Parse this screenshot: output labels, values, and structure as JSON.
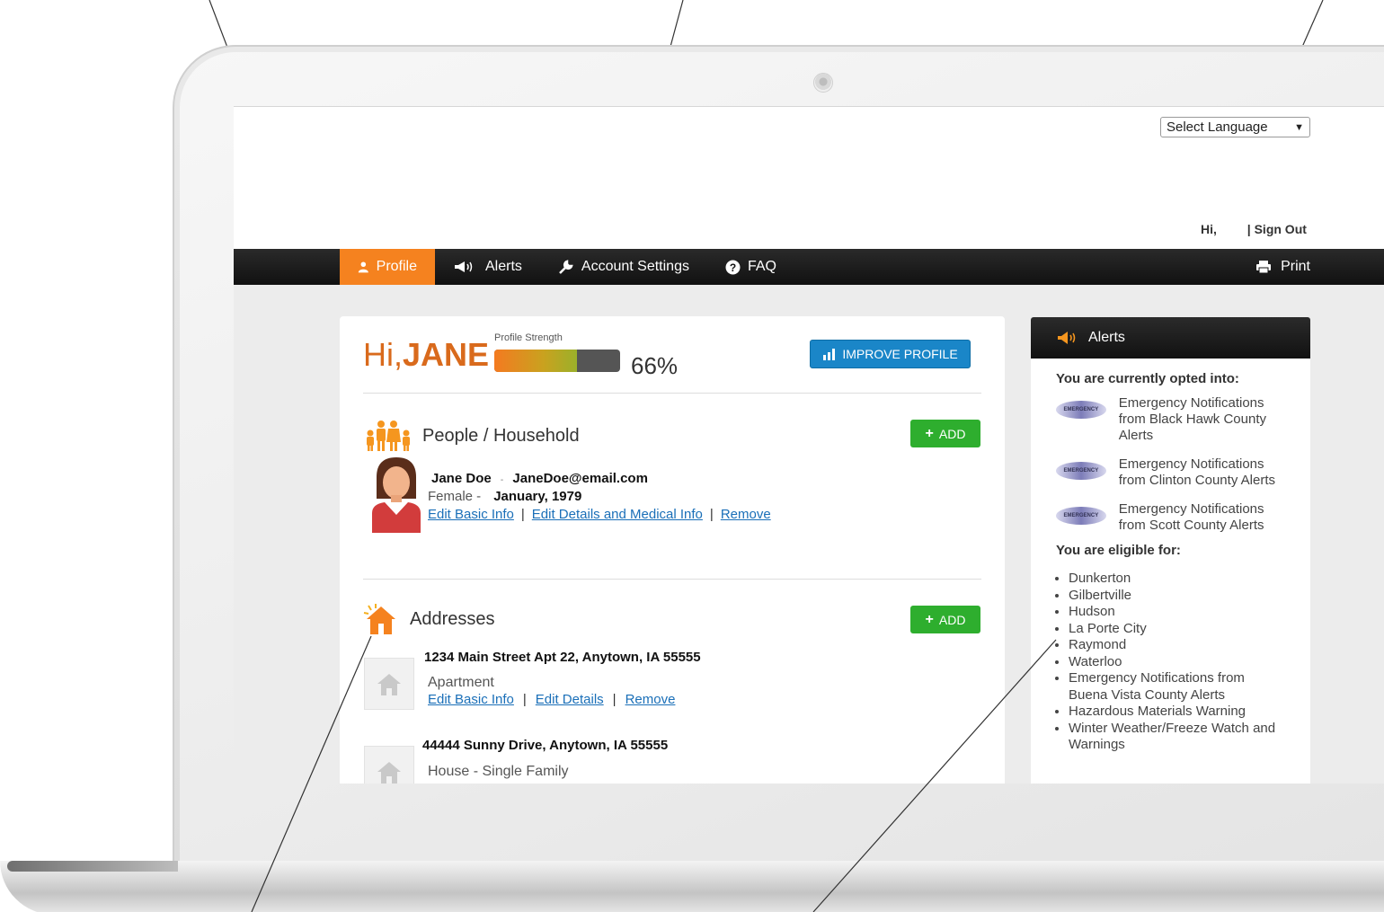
{
  "header": {
    "language_select": "Select Language",
    "greeting": "Hi,",
    "sign_out": "| Sign Out"
  },
  "nav": {
    "items": [
      {
        "label": "Profile",
        "icon": "person-icon",
        "active": true
      },
      {
        "label": "Alerts",
        "icon": "megaphone-icon",
        "active": false
      },
      {
        "label": "Account Settings",
        "icon": "wrench-icon",
        "active": false
      },
      {
        "label": "FAQ",
        "icon": "question-icon",
        "active": false
      }
    ],
    "print": "Print"
  },
  "profile": {
    "hi": "Hi,",
    "name": "JANE",
    "strength_label": "Profile Strength",
    "strength_pct": "66%",
    "strength_value": 0.66,
    "improve_button": "IMPROVE PROFILE"
  },
  "people": {
    "title": "People / Household",
    "add_label": "ADD",
    "person": {
      "name": "Jane Doe",
      "separator": "-",
      "email": "JaneDoe@email.com",
      "gender": "Female -",
      "birth": "January, 1979",
      "links": [
        "Edit Basic Info",
        "Edit Details and Medical Info",
        "Remove"
      ]
    }
  },
  "addresses": {
    "title": "Addresses",
    "add_label": "ADD",
    "items": [
      {
        "address": "1234 Main Street Apt 22, Anytown, IA 55555",
        "type": "Apartment",
        "links": [
          "Edit Basic Info",
          "Edit Details",
          "Remove"
        ]
      },
      {
        "address": "44444 Sunny Drive, Anytown, IA 55555",
        "type": "House - Single Family"
      }
    ]
  },
  "alerts": {
    "title": "Alerts",
    "opted_heading": "You are currently opted into:",
    "subscriptions": [
      "Emergency Notifications from Black Hawk County Alerts",
      "Emergency Notifications from Clinton County Alerts",
      "Emergency Notifications from Scott County Alerts"
    ],
    "eligible_heading": "You are eligible for:",
    "eligible": [
      "Dunkerton",
      "Gilbertville",
      "Hudson",
      "La Porte City",
      "Raymond",
      "Waterloo",
      "Emergency Notifications from Buena Vista County Alerts",
      "Hazardous Materials Warning",
      "Winter Weather/Freeze Watch and Warnings"
    ]
  },
  "colors": {
    "accent": "#f5821f",
    "nav_bg": "#111111",
    "link": "#1a6fb8",
    "add_green": "#2eae2e",
    "improve_blue": "#1a86c8"
  }
}
